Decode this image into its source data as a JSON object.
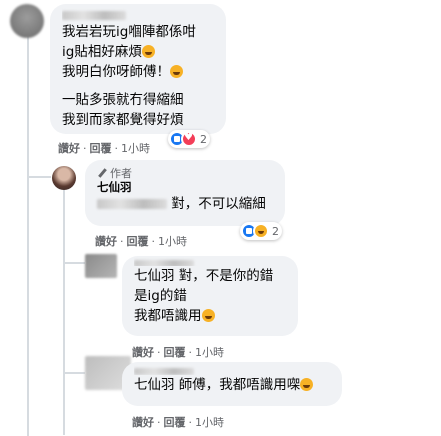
{
  "comment1": {
    "name": "Beverly Or",
    "lines": [
      "我岩岩玩ig嗰陣都係咁",
      "ig貼相好麻煩",
      "我明白你呀師傅！"
    ],
    "lines2": [
      "一貼多張就冇得縮細",
      "我到而家都覺得好煩"
    ],
    "emoji1": "face-emoji",
    "emoji2": "face-emoji",
    "actions": {
      "like": "讚好",
      "reply": "回覆",
      "time": "1小時"
    },
    "reactions": {
      "icons": [
        "like-icon",
        "love-icon"
      ],
      "count": "2"
    }
  },
  "reply1": {
    "author_badge": "作者",
    "name": "七仙羽",
    "mention_suffix": "對，不可以縮細",
    "actions": {
      "like": "讚好",
      "reply": "回覆",
      "time": "1小時"
    },
    "reactions": {
      "icons": [
        "like-icon",
        "haha-icon"
      ],
      "count": "2"
    }
  },
  "reply2": {
    "name": "Beverly Or",
    "line1": "七仙羽 對，不是你的錯",
    "line2": "是ig的錯",
    "line3": "我都唔識用",
    "actions": {
      "like": "讚好",
      "reply": "回覆",
      "time": "1小時"
    }
  },
  "reply3": {
    "text": "七仙羽 師傅，我都唔識用㗎",
    "actions": {
      "like": "讚好",
      "reply": "回覆",
      "time": "1小時"
    }
  },
  "separator": "·",
  "colors": {
    "bubble": "#f0f2f5",
    "meta": "#65676b",
    "like": "#1877f2",
    "love": "#f33e58",
    "haha": "#f7b125"
  }
}
